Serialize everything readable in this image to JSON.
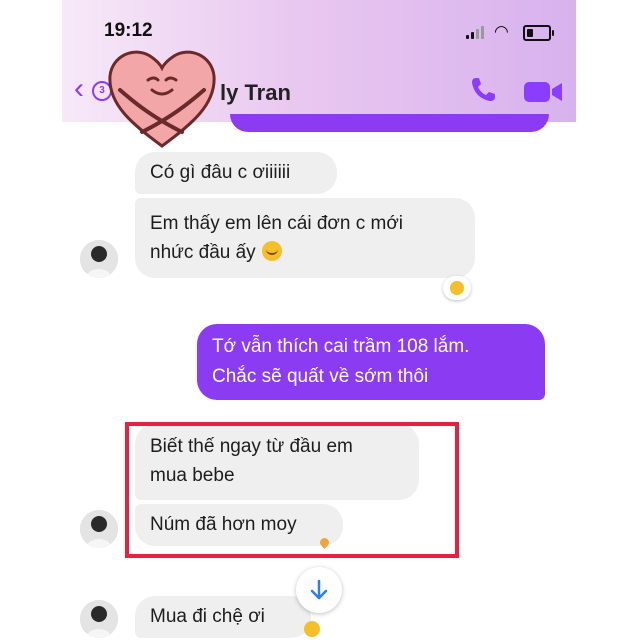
{
  "status_bar": {
    "time": "19:12"
  },
  "header": {
    "back_icon": "chevron-left-icon",
    "unread_count": "3",
    "contact_name": "ly Tran",
    "call_icon": "phone-icon",
    "video_icon": "video-camera-icon"
  },
  "messages": {
    "in1": "Có gì đâu c ơiiiiii",
    "in2_line1": "Em thấy em lên cái đơn c mới",
    "in2_line2": "nhức đầu ấy",
    "out1_line1": "Tớ vẫn thích cai trầm 108 lắm.",
    "out1_line2": "Chắc sẽ quất về sớm thôi",
    "in3_line1": "Biết thế ngay từ đầu em",
    "in3_line2": "mua bebe",
    "in4": "Núm đã hơn moy",
    "in5": "Mua đi chệ ơi"
  },
  "scroll_down_icon": "arrow-down-icon",
  "colors": {
    "accent": "#8b3cf3",
    "highlight_border": "#e7203f",
    "incoming_bubble": "#efefef"
  }
}
